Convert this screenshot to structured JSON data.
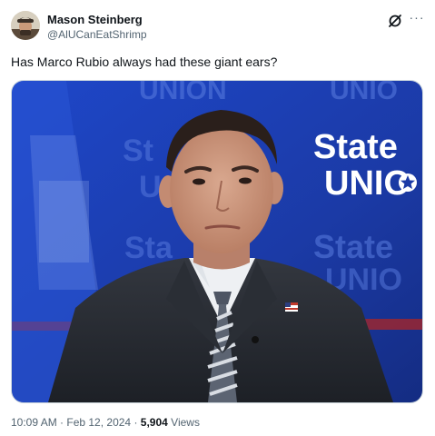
{
  "tweet": {
    "author_name": "Mason Steinberg",
    "author_handle": "@AlUCanEatShrimp",
    "text": "Has Marco Rubio always had these giant ears?",
    "time": "10:09 AM",
    "date": "Feb 12, 2024",
    "views_count": "5,904",
    "views_label": "Views",
    "separator": " · "
  },
  "media": {
    "background_texts": {
      "union_top_left": "UNION",
      "union_top_right": "UNIO",
      "left_s1": "St",
      "left_u1": "U",
      "left_s2": "Sta",
      "right_state_mid": "State",
      "right_union_mid": "UNIO"
    },
    "logo": {
      "line1": "State",
      "line2": "UNIO"
    }
  },
  "icons": {
    "grok": "grok-icon",
    "more": "more-icon"
  },
  "colors": {
    "studio_blue": "#1c3fb0",
    "text_primary": "#0f1419",
    "text_secondary": "#536471"
  }
}
